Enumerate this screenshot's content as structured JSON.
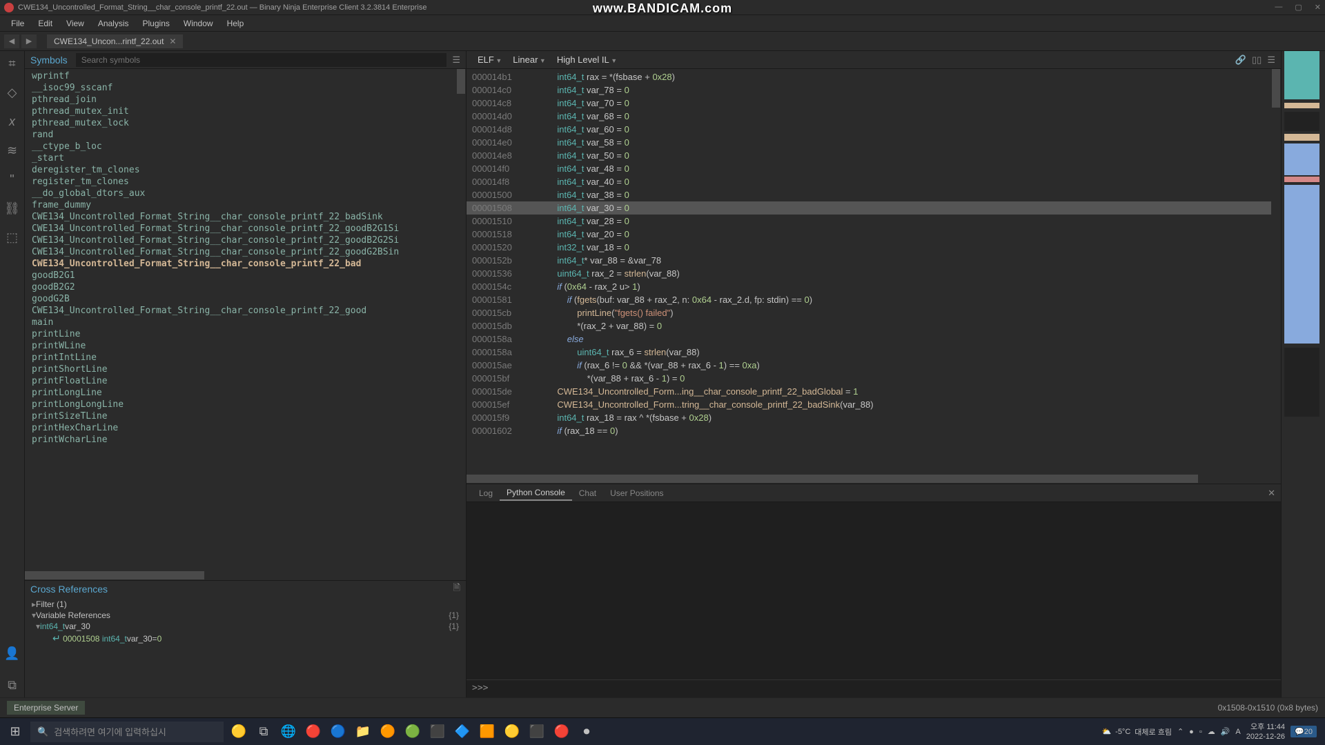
{
  "titlebar": {
    "text": "CWE134_Uncontrolled_Format_String__char_console_printf_22.out — Binary Ninja Enterprise Client 3.2.3814 Enterprise"
  },
  "watermark": "www.BANDICAM.com",
  "menubar": [
    "File",
    "Edit",
    "View",
    "Analysis",
    "Plugins",
    "Window",
    "Help"
  ],
  "tab": {
    "label": "CWE134_Uncon...rintf_22.out"
  },
  "symbols": {
    "title": "Symbols",
    "search_placeholder": "Search symbols",
    "items": [
      "wprintf",
      "__isoc99_sscanf",
      "pthread_join",
      "pthread_mutex_init",
      "pthread_mutex_lock",
      "rand",
      "__ctype_b_loc",
      "_start",
      "deregister_tm_clones",
      "register_tm_clones",
      "__do_global_dtors_aux",
      "frame_dummy",
      "CWE134_Uncontrolled_Format_String__char_console_printf_22_badSink",
      "CWE134_Uncontrolled_Format_String__char_console_printf_22_goodB2G1Si",
      "CWE134_Uncontrolled_Format_String__char_console_printf_22_goodB2G2Si",
      "CWE134_Uncontrolled_Format_String__char_console_printf_22_goodG2BSin",
      "CWE134_Uncontrolled_Format_String__char_console_printf_22_bad",
      "goodB2G1",
      "goodB2G2",
      "goodG2B",
      "CWE134_Uncontrolled_Format_String__char_console_printf_22_good",
      "main",
      "printLine",
      "printWLine",
      "printIntLine",
      "printShortLine",
      "printFloatLine",
      "printLongLine",
      "printLongLongLine",
      "printSizeTLine",
      "printHexCharLine",
      "printWcharLine"
    ],
    "bold_index": 16
  },
  "xrefs": {
    "title": "Cross References",
    "filter_label": "Filter (1)",
    "varrefs_label": "Variable References",
    "varrefs_count": "{1}",
    "var_label": "int64_t var_30",
    "var_count": "{1}",
    "ref_addr": "00001508",
    "ref_code": "int64_t var_30 = 0"
  },
  "view": {
    "selectors": [
      "ELF",
      "Linear",
      "High Level IL"
    ]
  },
  "code": [
    {
      "addr": "000014b1",
      "html": "<span class='type'>int64_t</span> <span class='var'>rax</span> = *(<span class='var'>fsbase</span> + <span class='num'>0x28</span>)",
      "indent": 3
    },
    {
      "addr": "000014c0",
      "html": "<span class='type'>int64_t</span> <span class='var'>var_78</span> = <span class='num'>0</span>",
      "indent": 3
    },
    {
      "addr": "000014c8",
      "html": "<span class='type'>int64_t</span> <span class='var'>var_70</span> = <span class='num'>0</span>",
      "indent": 3
    },
    {
      "addr": "000014d0",
      "html": "<span class='type'>int64_t</span> <span class='var'>var_68</span> = <span class='num'>0</span>",
      "indent": 3
    },
    {
      "addr": "000014d8",
      "html": "<span class='type'>int64_t</span> <span class='var'>var_60</span> = <span class='num'>0</span>",
      "indent": 3
    },
    {
      "addr": "000014e0",
      "html": "<span class='type'>int64_t</span> <span class='var'>var_58</span> = <span class='num'>0</span>",
      "indent": 3
    },
    {
      "addr": "000014e8",
      "html": "<span class='type'>int64_t</span> <span class='var'>var_50</span> = <span class='num'>0</span>",
      "indent": 3
    },
    {
      "addr": "000014f0",
      "html": "<span class='type'>int64_t</span> <span class='var'>var_48</span> = <span class='num'>0</span>",
      "indent": 3
    },
    {
      "addr": "000014f8",
      "html": "<span class='type'>int64_t</span> <span class='var'>var_40</span> = <span class='num'>0</span>",
      "indent": 3
    },
    {
      "addr": "00001500",
      "html": "<span class='type'>int64_t</span> <span class='var'>var_38</span> = <span class='num'>0</span>",
      "indent": 3
    },
    {
      "addr": "00001508",
      "html": "<span class='type'>int64_t</span> <span class='var'>var_30</span> = <span class='num'>0</span>",
      "indent": 3,
      "hl": true
    },
    {
      "addr": "00001510",
      "html": "<span class='type'>int64_t</span> <span class='var'>var_28</span> = <span class='num'>0</span>",
      "indent": 3
    },
    {
      "addr": "00001518",
      "html": "<span class='type'>int64_t</span> <span class='var'>var_20</span> = <span class='num'>0</span>",
      "indent": 3
    },
    {
      "addr": "00001520",
      "html": "<span class='type'>int32_t</span> <span class='var'>var_18</span> = <span class='num'>0</span>",
      "indent": 3
    },
    {
      "addr": "0000152b",
      "html": "<span class='type'>int64_t</span>* <span class='var'>var_88</span> = &<span class='var'>var_78</span>",
      "indent": 3
    },
    {
      "addr": "00001536",
      "html": "<span class='type'>uint64_t</span> <span class='var'>rax_2</span> = <span class='fn'>strlen</span>(<span class='var'>var_88</span>)",
      "indent": 3
    },
    {
      "addr": "0000154c",
      "html": "<span class='kw'>if</span> (<span class='num'>0x64</span> - <span class='var'>rax_2</span> u&gt; <span class='num'>1</span>)",
      "indent": 3
    },
    {
      "addr": "00001581",
      "html": "<span class='kw'>if</span> (<span class='fn'>fgets</span>(buf: <span class='var'>var_88</span> + <span class='var'>rax_2</span>, n: <span class='num'>0x64</span> - <span class='var'>rax_2</span>.d, fp: <span class='var'>stdin</span>) == <span class='num'>0</span>)",
      "indent": 4
    },
    {
      "addr": "000015cb",
      "html": "<span class='fn'>printLine</span>(<span class='str'>\"fgets() failed\"</span>)",
      "indent": 5
    },
    {
      "addr": "000015db",
      "html": "*(<span class='var'>rax_2</span> + <span class='var'>var_88</span>) = <span class='num'>0</span>",
      "indent": 5
    },
    {
      "addr": "0000158a",
      "html": "<span class='kw'>else</span>",
      "indent": 4
    },
    {
      "addr": "0000158a",
      "html": "<span class='type'>uint64_t</span> <span class='var'>rax_6</span> = <span class='fn'>strlen</span>(<span class='var'>var_88</span>)",
      "indent": 5
    },
    {
      "addr": "000015ae",
      "html": "<span class='kw'>if</span> (<span class='var'>rax_6</span> != <span class='num'>0</span> && *(<span class='var'>var_88</span> + <span class='var'>rax_6</span> - <span class='num'>1</span>) == <span class='num'>0xa</span>)",
      "indent": 5
    },
    {
      "addr": "000015bf",
      "html": "*(<span class='var'>var_88</span> + <span class='var'>rax_6</span> - <span class='num'>1</span>) = <span class='num'>0</span>",
      "indent": 6
    },
    {
      "addr": "000015de",
      "html": "<span class='fn'>CWE134_Uncontrolled_Form...ing__char_console_printf_22_badGlobal</span> = <span class='num'>1</span>",
      "indent": 3
    },
    {
      "addr": "000015ef",
      "html": "<span class='fn'>CWE134_Uncontrolled_Form...tring__char_console_printf_22_badSink</span>(<span class='var'>var_88</span>)",
      "indent": 3
    },
    {
      "addr": "000015f9",
      "html": "<span class='type'>int64_t</span> <span class='var'>rax_18</span> = <span class='var'>rax</span> ^ *(<span class='var'>fsbase</span> + <span class='num'>0x28</span>)",
      "indent": 3
    },
    {
      "addr": "00001602",
      "html": "<span class='kw'>if</span> (<span class='var'>rax_18</span> == <span class='num'>0</span>)",
      "indent": 3
    }
  ],
  "console": {
    "tabs": [
      "Log",
      "Python Console",
      "Chat",
      "User Positions"
    ],
    "active_tab": 1,
    "prompt": ">>>"
  },
  "statusbar": {
    "server": "Enterprise Server",
    "range": "0x1508-0x1510 (0x8 bytes)"
  },
  "taskbar": {
    "search_placeholder": "검색하려면 여기에 입력하십시",
    "weather_temp": "-5°C",
    "weather_text": "대체로 흐림",
    "time": "오후 11:44",
    "date": "2022-12-26",
    "notif_count": "20"
  }
}
